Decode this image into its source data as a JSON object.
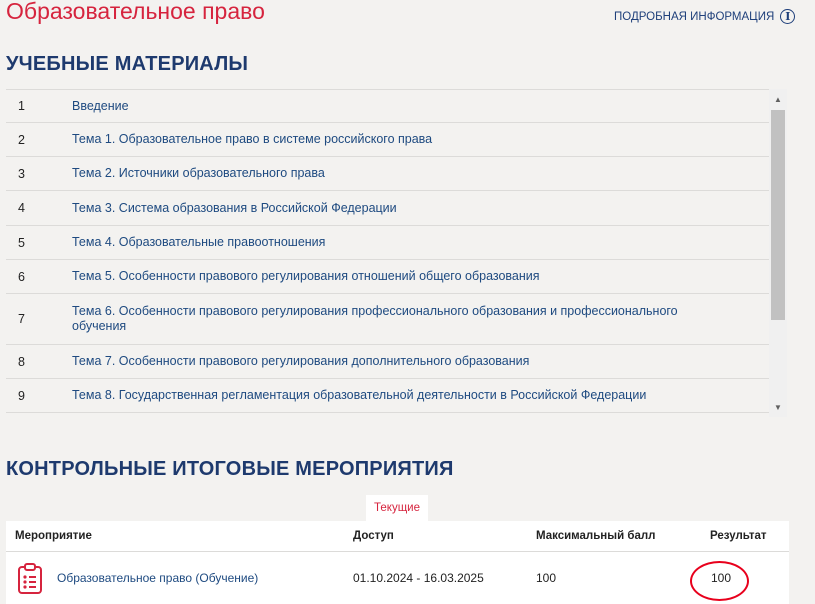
{
  "page": {
    "title": "Образовательное право",
    "info_link": "ПОДРОБНАЯ ИНФОРМАЦИЯ",
    "info_icon": "info-icon"
  },
  "materials": {
    "heading": "УЧЕБНЫЕ МАТЕРИАЛЫ",
    "items": [
      {
        "num": "1",
        "title": "Введение"
      },
      {
        "num": "2",
        "title": "Тема 1. Образовательное право в системе российского права"
      },
      {
        "num": "3",
        "title": "Тема 2. Источники образовательного права"
      },
      {
        "num": "4",
        "title": "Тема 3. Система образования в Российской Федерации"
      },
      {
        "num": "5",
        "title": "Тема 4. Образовательные правоотношения"
      },
      {
        "num": "6",
        "title": "Тема 5. Особенности правового регулирования отношений общего образования"
      },
      {
        "num": "7",
        "title": "Тема 6. Особенности правового регулирования профессионального образования и профессионального обучения"
      },
      {
        "num": "8",
        "title": "Тема 7. Особенности правового регулирования дополнительного образования"
      },
      {
        "num": "9",
        "title": "Тема 8. Государственная регламентация образовательной деятельности в Российской Федерации"
      }
    ]
  },
  "events": {
    "heading": "КОНТРОЛЬНЫЕ ИТОГОВЫЕ МЕРОПРИЯТИЯ",
    "tab_current": "Текущие",
    "columns": {
      "event": "Мероприятие",
      "access": "Доступ",
      "max_score": "Максимальный балл",
      "result": "Результат"
    },
    "rows": [
      {
        "icon": "clipboard-list-icon",
        "event": "Образовательное право (Обучение)",
        "access": "01.10.2024 - 16.03.2025",
        "max_score": "100",
        "result": "100"
      }
    ]
  },
  "colors": {
    "title_red": "#d6243e",
    "heading_navy": "#1e3a6e",
    "link_blue": "#1e4a80",
    "annotation_red": "#e8001c"
  }
}
